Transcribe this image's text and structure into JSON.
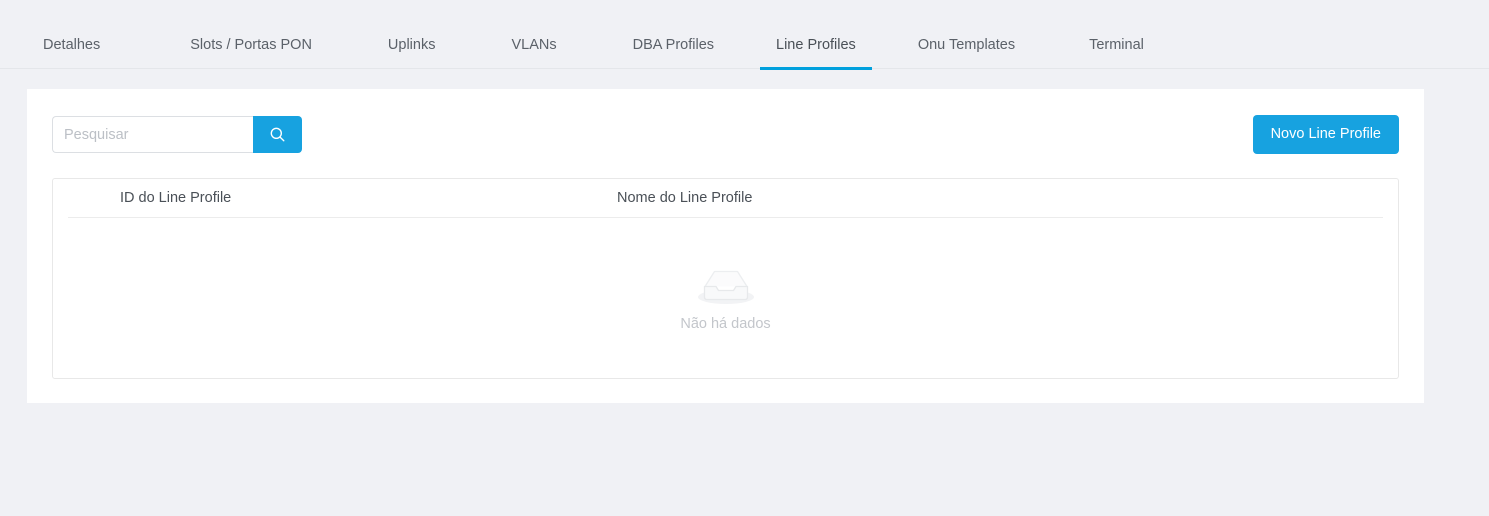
{
  "theme": {
    "page_background": "#f0f1f5",
    "card_background": "#ffffff",
    "accent": "#17a2e0",
    "tab_active_underline": "#00a0dd",
    "text_primary": "#4a5057",
    "text_muted": "#c3c6cb",
    "border": "#e8e8e8"
  },
  "tabs": [
    {
      "label": "Detalhes",
      "active": false
    },
    {
      "label": "Slots / Portas PON",
      "active": false
    },
    {
      "label": "Uplinks",
      "active": false
    },
    {
      "label": "VLANs",
      "active": false
    },
    {
      "label": "DBA Profiles",
      "active": false
    },
    {
      "label": "Line Profiles",
      "active": true
    },
    {
      "label": "Onu Templates",
      "active": false
    },
    {
      "label": "Terminal",
      "active": false
    }
  ],
  "toolbar": {
    "search": {
      "value": "",
      "placeholder": "Pesquisar",
      "icon": "search-icon"
    },
    "primary_action": {
      "label": "Novo Line Profile"
    }
  },
  "table": {
    "columns": [
      {
        "label": "ID do Line Profile"
      },
      {
        "label": "Nome do Line Profile"
      }
    ],
    "rows": [],
    "empty_state": {
      "icon": "empty-inbox-icon",
      "text": "Não há dados"
    }
  }
}
